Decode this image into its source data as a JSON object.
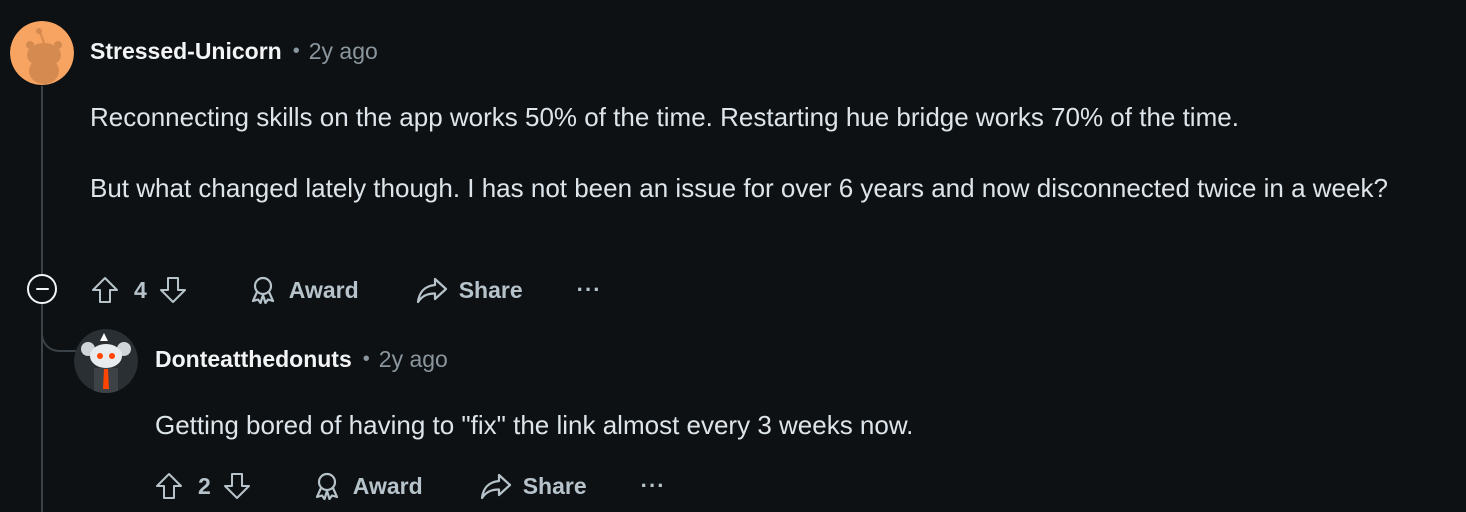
{
  "comments": [
    {
      "username": "Stressed-Unicorn",
      "separator": "•",
      "time": "2y ago",
      "paragraphs": [
        "Reconnecting skills on the app works 50% of the time. Restarting hue bridge works 70% of the time.",
        "But what changed lately though. I has not been an issue for over 6 years and now disconnected twice in a week?"
      ],
      "score": "4",
      "award_label": "Award",
      "share_label": "Share",
      "more_label": "···",
      "avatar_color": "#f7a462"
    },
    {
      "username": "Donteatthedonuts",
      "separator": "•",
      "time": "2y ago",
      "paragraphs": [
        "Getting bored of having to \"fix\" the link almost every 3 weeks now."
      ],
      "score": "2",
      "award_label": "Award",
      "share_label": "Share",
      "more_label": "···",
      "avatar_color": "#2a2f33"
    }
  ],
  "icons": {
    "upvote": "upvote-icon",
    "downvote": "downvote-icon",
    "award": "award-icon",
    "share": "share-icon",
    "collapse": "collapse-icon"
  },
  "colors": {
    "background": "#0e1113",
    "username": "#f2f4f5",
    "body_text": "#dde5ea",
    "meta_text": "#8a969e",
    "thread_line": "#3a4247"
  }
}
